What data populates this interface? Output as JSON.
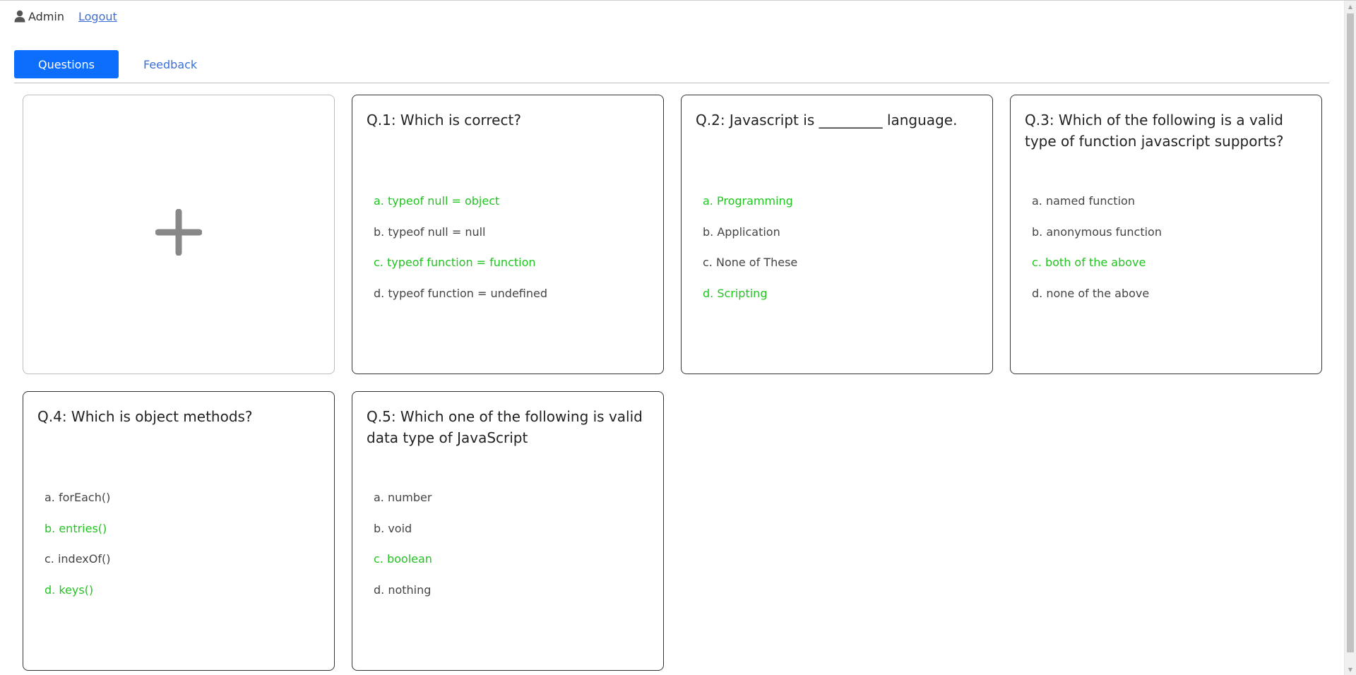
{
  "header": {
    "user_icon": "user-icon",
    "username": "Admin",
    "logout_label": "Logout"
  },
  "tabs": [
    {
      "label": "Questions",
      "active": true
    },
    {
      "label": "Feedback",
      "active": false
    }
  ],
  "add_card": {
    "icon": "plus-icon"
  },
  "colors": {
    "accent": "#0d6efd",
    "correct": "#22c422",
    "link": "#3a6fd8"
  },
  "questions": [
    {
      "title": "Q.1: Which is correct?",
      "options": [
        {
          "text": "a. typeof null = object",
          "correct": true
        },
        {
          "text": "b. typeof null = null",
          "correct": false
        },
        {
          "text": "c. typeof function = function",
          "correct": true
        },
        {
          "text": "d. typeof function = undefined",
          "correct": false
        }
      ]
    },
    {
      "title": "Q.2: Javascript is _________ language.",
      "options": [
        {
          "text": "a. Programming",
          "correct": true
        },
        {
          "text": "b. Application",
          "correct": false
        },
        {
          "text": "c. None of These",
          "correct": false
        },
        {
          "text": "d. Scripting",
          "correct": true
        }
      ]
    },
    {
      "title": "Q.3: Which of the following is a valid type of function javascript supports?",
      "options": [
        {
          "text": "a. named function",
          "correct": false
        },
        {
          "text": "b. anonymous function",
          "correct": false
        },
        {
          "text": "c. both of the above",
          "correct": true
        },
        {
          "text": "d. none of the above",
          "correct": false
        }
      ]
    },
    {
      "title": "Q.4: Which is object methods?",
      "options": [
        {
          "text": "a. forEach()",
          "correct": false
        },
        {
          "text": "b. entries()",
          "correct": true
        },
        {
          "text": "c. indexOf()",
          "correct": false
        },
        {
          "text": "d. keys()",
          "correct": true
        }
      ]
    },
    {
      "title": "Q.5: Which one of the following is valid data type of JavaScript",
      "options": [
        {
          "text": "a. number",
          "correct": false
        },
        {
          "text": "b. void",
          "correct": false
        },
        {
          "text": "c. boolean",
          "correct": true
        },
        {
          "text": "d. nothing",
          "correct": false
        }
      ]
    }
  ]
}
